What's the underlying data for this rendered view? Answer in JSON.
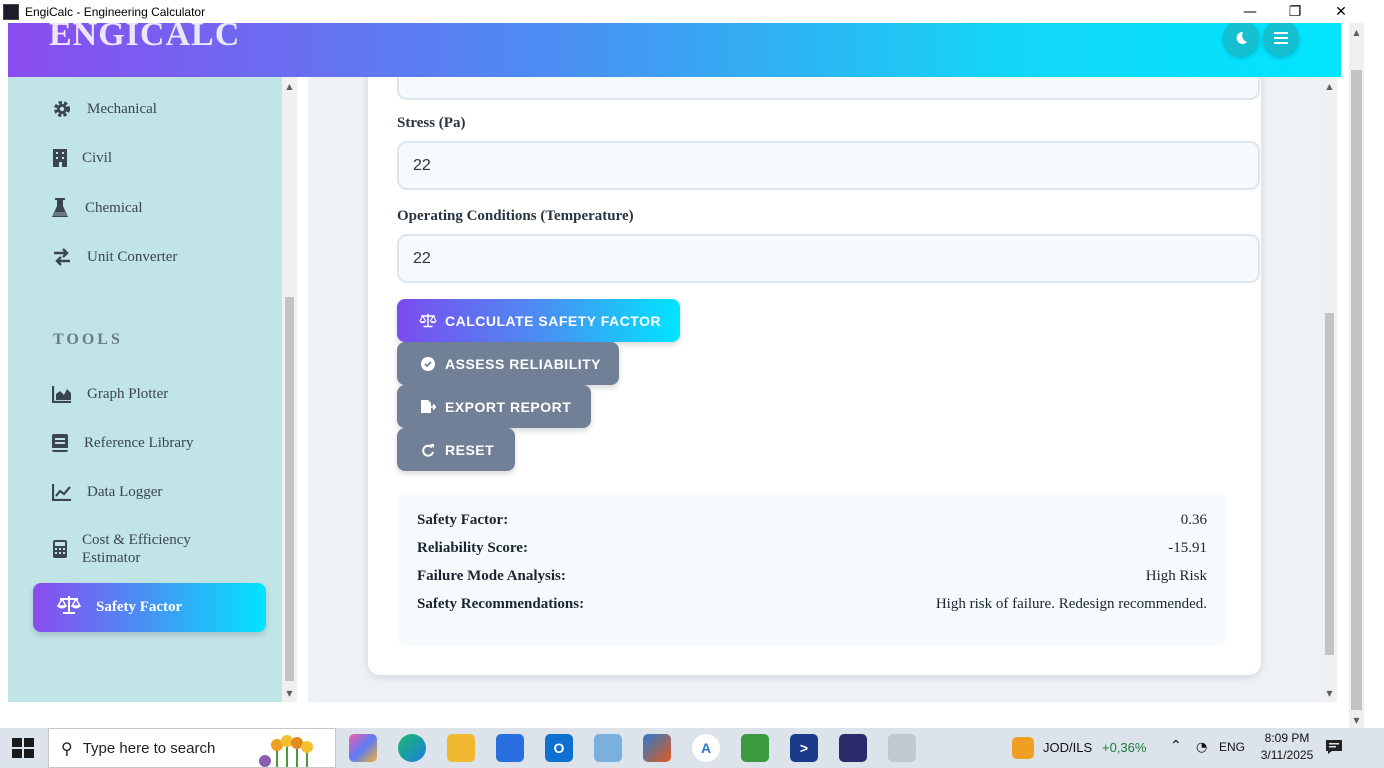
{
  "window": {
    "title": "EngiCalc - Engineering Calculator",
    "minimize": "—",
    "restore": "❐",
    "close": "✕"
  },
  "header": {
    "brand": "ENGICALC",
    "theme_icon": "moon-icon",
    "menu_icon": "hamburger-menu-icon",
    "gradient_start": "#8a4cf0",
    "gradient_end": "#00e5ff"
  },
  "sidebar": {
    "items": [
      {
        "label": "Mechanical",
        "icon": "gear-icon"
      },
      {
        "label": "Civil",
        "icon": "building-icon"
      },
      {
        "label": "Chemical",
        "icon": "flask-icon"
      },
      {
        "label": "Unit Converter",
        "icon": "exchange-arrows-icon"
      }
    ],
    "section_tools": "TOOLS",
    "tools": [
      {
        "label": "Graph Plotter",
        "icon": "area-chart-icon"
      },
      {
        "label": "Reference Library",
        "icon": "book-icon"
      },
      {
        "label": "Data Logger",
        "icon": "line-chart-icon"
      },
      {
        "label": "Cost & Efficiency Estimator",
        "icon": "calculator-icon"
      }
    ],
    "active": {
      "label": "Safety Factor",
      "icon": "balance-scale-icon"
    }
  },
  "form": {
    "stress_label": "Stress (Pa)",
    "stress_value": "22",
    "operating_label": "Operating Conditions (Temperature)",
    "operating_value": "22"
  },
  "buttons": {
    "calculate": "CALCULATE SAFETY FACTOR",
    "assess": "ASSESS RELIABILITY",
    "export": "EXPORT REPORT",
    "reset": "RESET"
  },
  "results": [
    {
      "key": "Safety Factor:",
      "value": "0.36"
    },
    {
      "key": "Reliability Score:",
      "value": "-15.91"
    },
    {
      "key": "Failure Mode Analysis:",
      "value": "High Risk"
    },
    {
      "key": "Safety Recommendations:",
      "value": "High risk of failure. Redesign recommended."
    }
  ],
  "taskbar": {
    "search_placeholder": "Type here to search",
    "ticker_label": "JOD/ILS",
    "ticker_value": "+0,36%",
    "language": "ENG",
    "time": "8:09 PM",
    "date": "3/11/2025"
  }
}
